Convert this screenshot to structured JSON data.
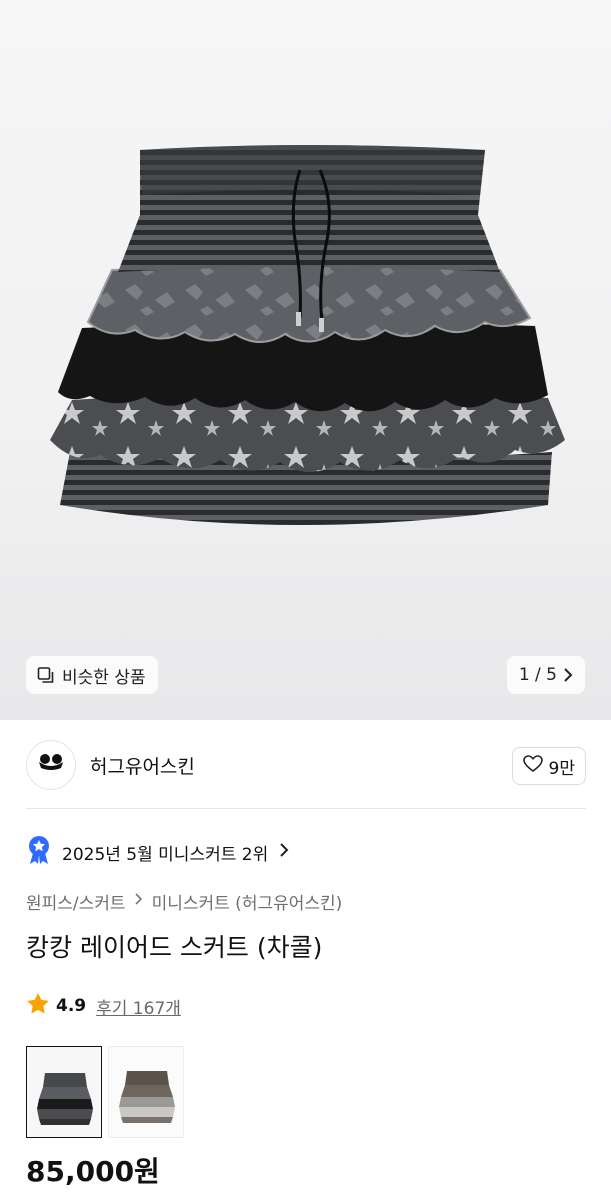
{
  "hero": {
    "image_alt": "charcoal layered skirt product photo",
    "similar_label": "비슷한 상품",
    "counter": "1 / 5",
    "icons": {
      "similar": "similar-items-icon",
      "next": "chevron-right-icon"
    }
  },
  "brand": {
    "name": "허그유어스킨",
    "logo_text": "hugyourskin",
    "like_count": "9만",
    "like_icon": "heart-outline-icon"
  },
  "ranking": {
    "text": "2025년 5월 미니스커트 2위",
    "badge_icon": "ranking-badge-icon",
    "badge_color": "#2f6bff"
  },
  "breadcrumb": {
    "category": "원피스/스커트",
    "subcategory": "미니스커트 (허그유어스킨)"
  },
  "product": {
    "title": "캉캉 레이어드 스커트 (차콜)",
    "rating": "4.9",
    "review_label": "후기 167개",
    "star_color": "#f7a400",
    "price": "85,000원"
  },
  "color_options": [
    {
      "name": "charcoal",
      "selected": true
    },
    {
      "name": "brown",
      "selected": false
    }
  ]
}
